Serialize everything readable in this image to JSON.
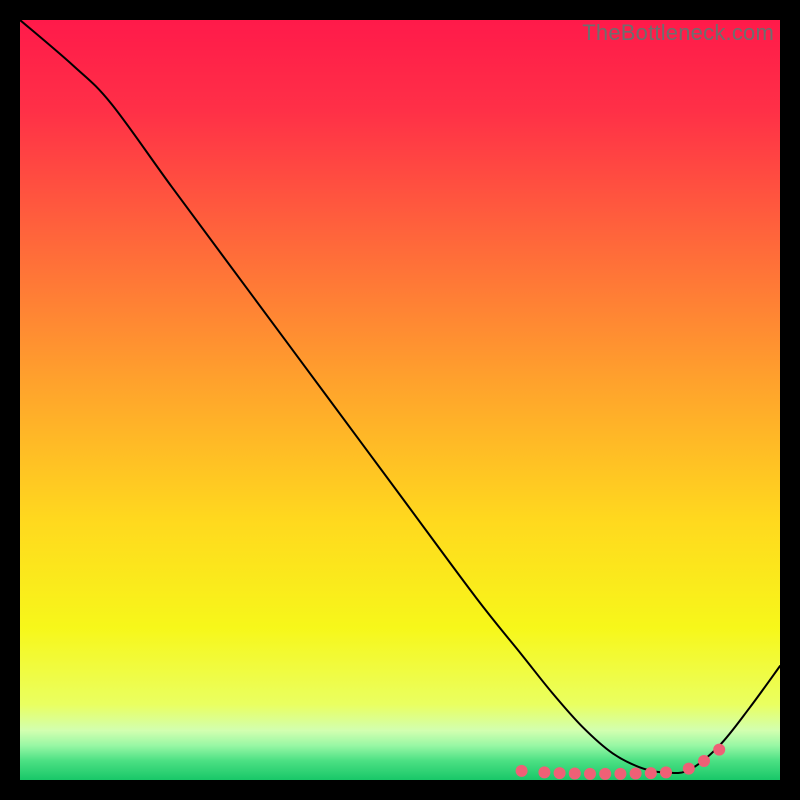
{
  "watermark": "TheBottleneck.com",
  "chart_data": {
    "type": "line",
    "title": "",
    "xlabel": "",
    "ylabel": "",
    "xlim": [
      0,
      100
    ],
    "ylim": [
      0,
      100
    ],
    "grid": false,
    "series": [
      {
        "name": "curve",
        "type": "line",
        "x": [
          0,
          7,
          12,
          20,
          30,
          40,
          50,
          60,
          66,
          70,
          74,
          78,
          82,
          85,
          88,
          92,
          96,
          100
        ],
        "y": [
          100,
          94,
          89,
          78,
          64.5,
          51,
          37.5,
          24,
          16.5,
          11.5,
          7,
          3.5,
          1.5,
          1,
          1.3,
          4.5,
          9.5,
          15
        ]
      },
      {
        "name": "flat-markers",
        "type": "scatter",
        "color": "#ef6076",
        "x": [
          66,
          69,
          71,
          73,
          75,
          77,
          79,
          81,
          83,
          85,
          88,
          90,
          92
        ],
        "y": [
          1.2,
          1.0,
          0.9,
          0.85,
          0.8,
          0.8,
          0.8,
          0.85,
          0.9,
          1.0,
          1.5,
          2.5,
          4.0
        ]
      }
    ],
    "gradient_stops": [
      {
        "offset": 0.0,
        "color": "#ff1a4a"
      },
      {
        "offset": 0.12,
        "color": "#ff3047"
      },
      {
        "offset": 0.3,
        "color": "#ff6a3a"
      },
      {
        "offset": 0.48,
        "color": "#ffa32c"
      },
      {
        "offset": 0.66,
        "color": "#ffd91e"
      },
      {
        "offset": 0.8,
        "color": "#f7f71a"
      },
      {
        "offset": 0.9,
        "color": "#eaff60"
      },
      {
        "offset": 0.935,
        "color": "#d2ffb0"
      },
      {
        "offset": 0.955,
        "color": "#97f7a4"
      },
      {
        "offset": 0.975,
        "color": "#4be083"
      },
      {
        "offset": 1.0,
        "color": "#18c768"
      }
    ]
  }
}
